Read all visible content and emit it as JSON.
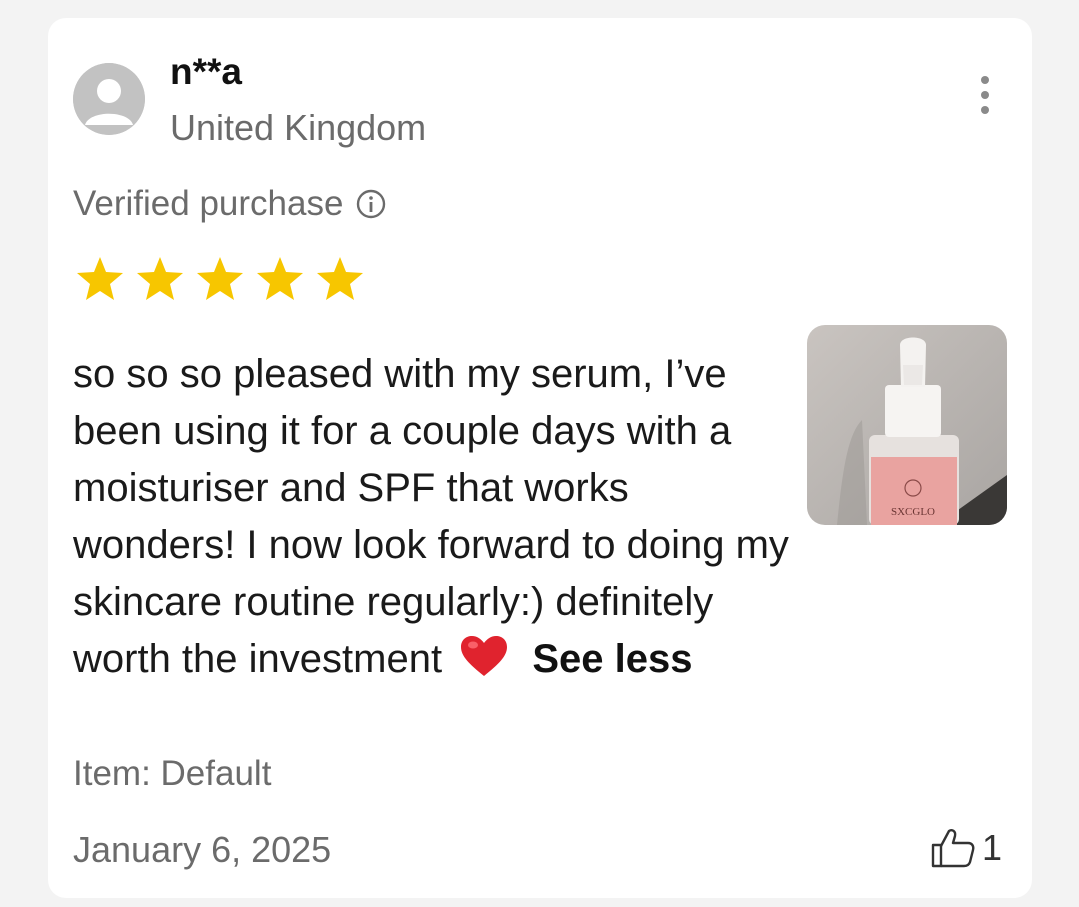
{
  "reviewer": {
    "name": "n**a",
    "country": "United Kingdom"
  },
  "verified": {
    "label": "Verified purchase"
  },
  "rating": {
    "stars": 5,
    "max": 5,
    "color": "#f7c600"
  },
  "review": {
    "text": "so so so pleased with my serum, I’ve been using it for a couple days with a moisturiser and SPF that works wonders! I now look forward to doing my skincare routine regularly:) definitely worth the investment",
    "emoji": "red-heart",
    "toggle_label": "See less"
  },
  "photo": {
    "brand_text": "SXCGLO",
    "label_color": "#e9a3a0"
  },
  "item": {
    "label": "Item: Default"
  },
  "date": "January 6, 2025",
  "helpful": {
    "icon": "thumbs-up-icon",
    "count": "1"
  },
  "menu": {
    "icon": "more-vertical-icon"
  }
}
